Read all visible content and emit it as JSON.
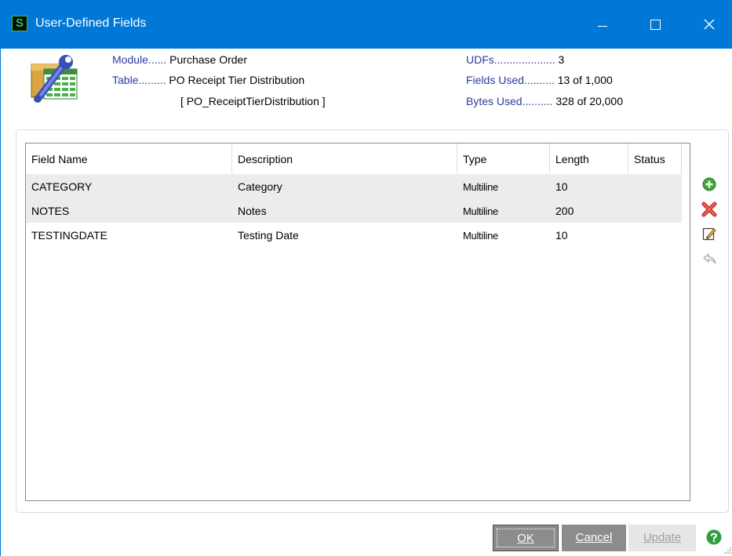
{
  "window": {
    "app_icon_glyph": "S",
    "title": "User-Defined Fields",
    "controls": {
      "minimize": "minimize-icon",
      "maximize": "maximize-icon",
      "close_glyph": "✕"
    }
  },
  "header": {
    "module_label": "Module......",
    "module_value": "Purchase Order",
    "table_label": "Table.........",
    "table_value": "PO Receipt Tier Distribution",
    "table_name": "[ PO_ReceiptTierDistribution ]",
    "udfs_label": "UDFs....................",
    "udfs_value": "3",
    "fields_used_label": "Fields Used..........",
    "fields_used_value": "13 of 1,000",
    "bytes_used_label": "Bytes Used..........",
    "bytes_used_value": "328 of 20,000"
  },
  "grid": {
    "columns": [
      "Field Name",
      "Description",
      "Type",
      "Length",
      "Status"
    ],
    "rows": [
      {
        "field_name": "CATEGORY",
        "description": "Category",
        "type": "Multiline",
        "length": "10",
        "status": ""
      },
      {
        "field_name": "NOTES",
        "description": "Notes",
        "type": "Multiline",
        "length": "200",
        "status": ""
      },
      {
        "field_name": "TESTINGDATE",
        "description": "Testing Date",
        "type": "Multiline",
        "length": "10",
        "status": ""
      }
    ]
  },
  "side_actions": [
    "add-icon",
    "delete-icon",
    "edit-icon",
    "undo-icon"
  ],
  "buttons": {
    "ok_label": "OK",
    "cancel_label": "Cancel",
    "update_label": "Update"
  },
  "colors": {
    "titlebar": "#0078d7",
    "label_blue": "#2b3b9c",
    "add_green": "#3fa535",
    "delete_red": "#e0413a",
    "help_green": "#2e9e3e"
  }
}
